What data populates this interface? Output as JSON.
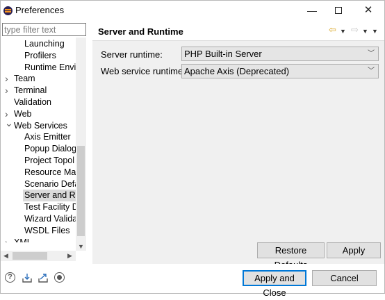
{
  "window": {
    "title": "Preferences"
  },
  "filter": {
    "placeholder": "type filter text"
  },
  "tree": {
    "items": [
      {
        "label": "Launching",
        "level": 2,
        "expandable": false,
        "selected": false
      },
      {
        "label": "Profilers",
        "level": 2,
        "expandable": false,
        "selected": false
      },
      {
        "label": "Runtime Envir",
        "level": 2,
        "expandable": false,
        "selected": false
      },
      {
        "label": "Team",
        "level": 1,
        "expandable": true,
        "expanded": false,
        "selected": false
      },
      {
        "label": "Terminal",
        "level": 1,
        "expandable": true,
        "expanded": false,
        "selected": false
      },
      {
        "label": "Validation",
        "level": 1,
        "expandable": false,
        "selected": false
      },
      {
        "label": "Web",
        "level": 1,
        "expandable": true,
        "expanded": false,
        "selected": false
      },
      {
        "label": "Web Services",
        "level": 1,
        "expandable": true,
        "expanded": true,
        "selected": false
      },
      {
        "label": "Axis Emitter",
        "level": 2,
        "expandable": false,
        "selected": false
      },
      {
        "label": "Popup Dialog",
        "level": 2,
        "expandable": false,
        "selected": false
      },
      {
        "label": "Project Topol",
        "level": 2,
        "expandable": false,
        "selected": false
      },
      {
        "label": "Resource Mar",
        "level": 2,
        "expandable": false,
        "selected": false
      },
      {
        "label": "Scenario Defa",
        "level": 2,
        "expandable": false,
        "selected": false
      },
      {
        "label": "Server and Ru",
        "level": 2,
        "expandable": false,
        "selected": true
      },
      {
        "label": "Test Facility D",
        "level": 2,
        "expandable": false,
        "selected": false
      },
      {
        "label": "Wizard Valida",
        "level": 2,
        "expandable": false,
        "selected": false
      },
      {
        "label": "WSDL Files",
        "level": 2,
        "expandable": false,
        "selected": false
      },
      {
        "label": "XML",
        "level": 1,
        "expandable": true,
        "expanded": false,
        "selected": false
      }
    ]
  },
  "page": {
    "title": "Server and Runtime",
    "server_runtime": {
      "label": "Server runtime:",
      "value": "PHP Built-in Server"
    },
    "web_service_runtime": {
      "label": "Web service runtime:",
      "value": "Apache Axis (Deprecated)"
    },
    "restore_defaults_label": "Restore Defaults",
    "apply_label": "Apply"
  },
  "footer": {
    "apply_and_close_label": "Apply and Close",
    "cancel_label": "Cancel"
  },
  "icons": {
    "help": "help-icon",
    "import": "import-icon",
    "export": "export-icon",
    "record": "record-icon",
    "back": "back-arrow-icon",
    "forward": "forward-arrow-icon"
  },
  "colors": {
    "accent": "#0078d7",
    "selection": "#dadada",
    "nav_back": "#d9a521"
  }
}
